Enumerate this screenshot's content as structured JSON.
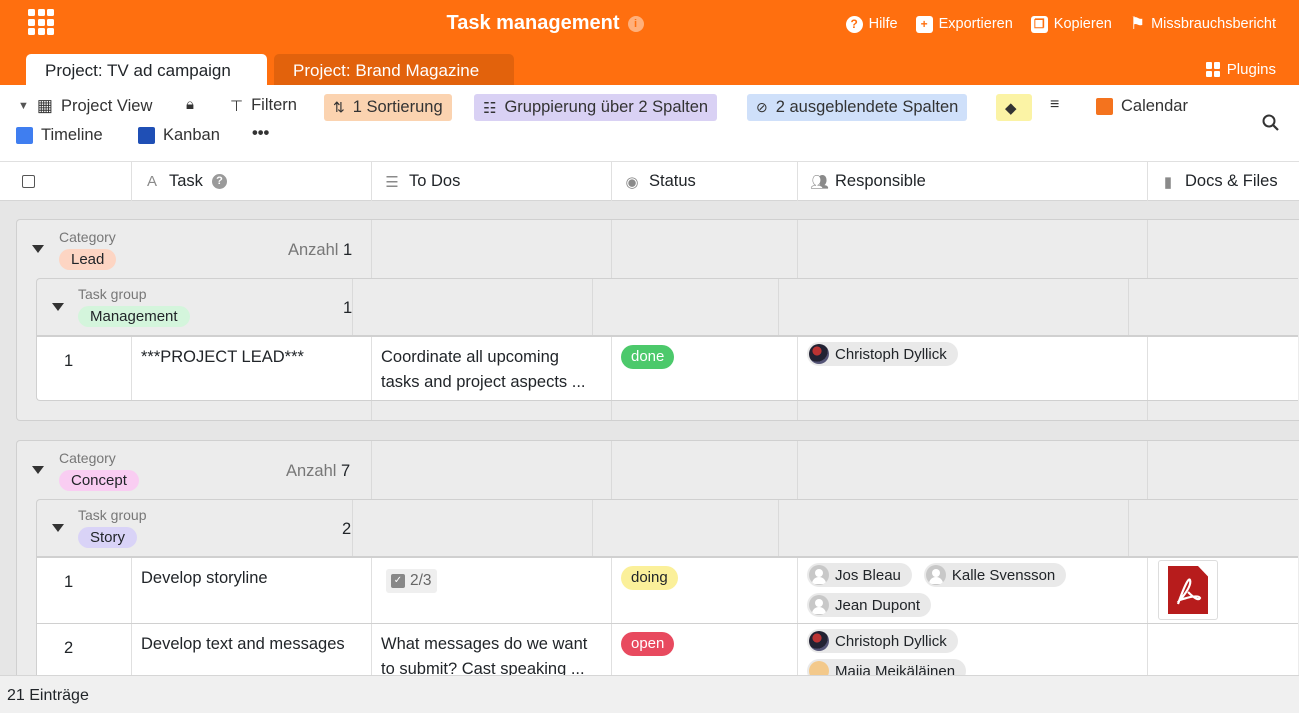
{
  "app": {
    "title": "Task management",
    "info_icon": "i"
  },
  "top_links": [
    {
      "label": "Hilfe",
      "icon": "help-icon"
    },
    {
      "label": "Exportieren",
      "icon": "export-icon"
    },
    {
      "label": "Kopieren",
      "icon": "copy-icon"
    },
    {
      "label": "Missbrauchsbericht",
      "icon": "flag-icon"
    }
  ],
  "tabs": [
    {
      "label": "Project: TV ad campaign",
      "active": true
    },
    {
      "label": "Project: Brand Magazine",
      "active": false
    }
  ],
  "plugins_label": "Plugins",
  "toolbar": {
    "view": "Project View",
    "filter": "Filtern",
    "sort": "1 Sortierung",
    "group": "Gruppierung über 2 Spalten",
    "hidden": "2 ausgeblendete Spalten",
    "calendar": "Calendar",
    "timeline": "Timeline",
    "kanban": "Kanban",
    "more": "•••"
  },
  "colors": {
    "brand": "#ff6f0f",
    "sort_chip": "#fbd3b0",
    "group_chip": "#d9d1f4",
    "hidden_chip": "#cfe0fa",
    "color_chip": "#fbf3a5"
  },
  "columns": [
    "Task",
    "To Dos",
    "Status",
    "Responsible",
    "Docs & Files"
  ],
  "groups": [
    {
      "category_label": "Category",
      "category": "Lead",
      "category_color": "#fdd5c3",
      "count_label": "Anzahl",
      "count": "1",
      "subgroup": {
        "label": "Task group",
        "name": "Management",
        "color": "#d4f5dc",
        "count": "1",
        "rows": [
          {
            "num": "1",
            "task": "***PROJECT LEAD***",
            "todo_line1": "Coordinate all upcoming",
            "todo_line2": "tasks and project aspects ...",
            "status": "done",
            "status_color": "#4cc96b",
            "people": [
              "Christoph Dyllick"
            ]
          }
        ]
      }
    },
    {
      "category_label": "Category",
      "category": "Concept",
      "category_color": "#f9cdf2",
      "count_label": "Anzahl",
      "count": "7",
      "subgroup": {
        "label": "Task group",
        "name": "Story",
        "color": "#d9d3f7",
        "count": "2",
        "rows": [
          {
            "num": "1",
            "task": "Develop storyline",
            "todo_progress": "2/3",
            "status": "doing",
            "status_color": "#fbf09a",
            "people": [
              "Jos Bleau",
              "Kalle Svensson",
              "Jean Dupont"
            ],
            "file": "pdf-icon"
          },
          {
            "num": "2",
            "task": "Develop text and messages",
            "todo_line1": "What messages do we want",
            "todo_line2": "to submit? Cast speaking ...",
            "status": "open",
            "status_color": "#e84a5f",
            "people": [
              "Christoph Dyllick",
              "Maija Meikäläinen"
            ]
          }
        ]
      }
    }
  ],
  "footer": "21 Einträge"
}
